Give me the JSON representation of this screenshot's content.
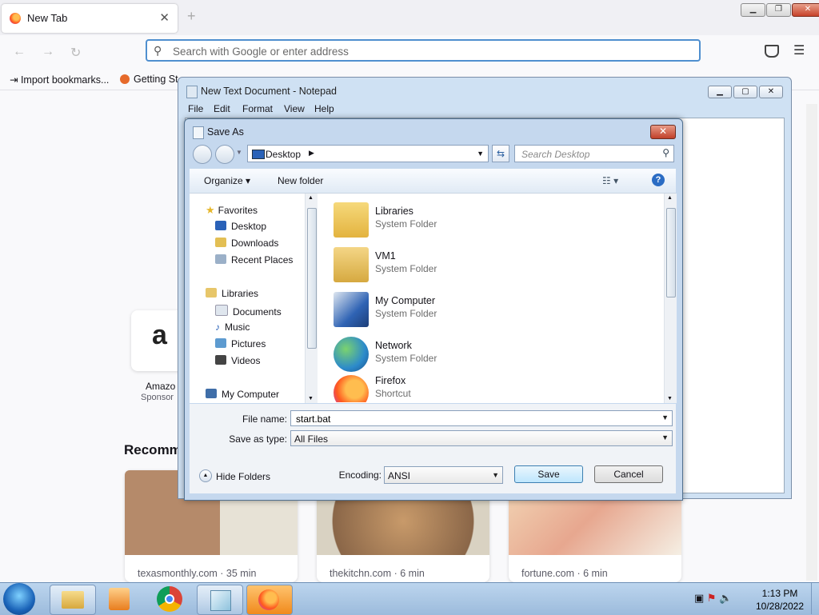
{
  "browser": {
    "tab_title": "New Tab",
    "tab_close": "✕",
    "new_tab": "+",
    "search_placeholder": "Search with Google or enter address",
    "bookmarks": [
      "Import bookmarks...",
      "Getting St"
    ],
    "tiles": [
      {
        "letter": "a",
        "label": "Amazo",
        "sublabel": "Sponsor"
      }
    ],
    "section_title": "Recomm",
    "stories": [
      {
        "source": "texasmonthly.com · 35 min"
      },
      {
        "source": "thekitchn.com · 6 min"
      },
      {
        "source": "fortune.com · 6 min"
      }
    ]
  },
  "notepad": {
    "title": "New Text Document - Notepad",
    "menu": [
      "File",
      "Edit",
      "Format",
      "View",
      "Help"
    ]
  },
  "dialog": {
    "title": "Save As",
    "location": "Desktop",
    "search_placeholder": "Search Desktop",
    "toolbar": {
      "organize": "Organize ▾",
      "new_folder": "New folder",
      "help": "?"
    },
    "nav": {
      "favorites": "Favorites",
      "favorites_items": [
        "Desktop",
        "Downloads",
        "Recent Places"
      ],
      "libraries": "Libraries",
      "libraries_items": [
        "Documents",
        "Music",
        "Pictures",
        "Videos"
      ],
      "computer": "My Computer"
    },
    "files": [
      {
        "name": "Libraries",
        "type": "System Folder",
        "icon": "libraries-icon"
      },
      {
        "name": "VM1",
        "type": "System Folder",
        "icon": "user-folder-icon"
      },
      {
        "name": "My Computer",
        "type": "System Folder",
        "icon": "computer-icon"
      },
      {
        "name": "Network",
        "type": "System Folder",
        "icon": "network-icon"
      },
      {
        "name": "Firefox",
        "type": "Shortcut",
        "icon": "firefox-icon"
      }
    ],
    "filename_label": "File name:",
    "filename_value": "start.bat",
    "savetype_label": "Save as type:",
    "savetype_value": "All Files",
    "hide_folders": "Hide Folders",
    "encoding_label": "Encoding:",
    "encoding_value": "ANSI",
    "save_label": "Save",
    "cancel_label": "Cancel"
  },
  "taskbar": {
    "time": "1:13 PM",
    "date": "10/28/2022"
  }
}
